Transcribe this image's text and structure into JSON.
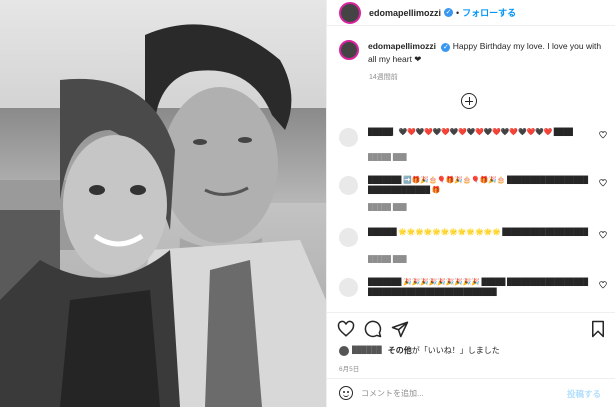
{
  "post": {
    "author": "edomapellimozzi",
    "follow_label": "フォローする",
    "caption": "Happy Birthday my love. I love you with all my heart ❤",
    "caption_time": "14週間前"
  },
  "comments": [
    {
      "text": "█████▎ 🖤❤️🖤❤️🖤❤️🖤❤️🖤❤️🖤❤️🖤❤️🖤❤️🖤❤️ ████",
      "meta": "█████  ███"
    },
    {
      "text": "███████ ➡️🎁🎉🎂🎈🎁🎉🎂🎈🎁🎉🎂 ██████████████████████████████ 🎁",
      "meta": "█████  ███"
    },
    {
      "text": "██████ 🌟🌟🌟🌟🌟🌟🌟🌟🌟🌟🌟🌟 ██████████████████",
      "meta": "█████  ███"
    },
    {
      "text": "███████ 🎉🎉🎉🎉🎉🎉🎉🎉🎉 █████ ████████████████████████████████████████████",
      "meta": "█████  ███"
    }
  ],
  "likes": {
    "liked_by": "██████",
    "label_prefix": "その他",
    "label_suffix": "が「いいね！」しました"
  },
  "post_date": "6月5日",
  "add_comment": {
    "placeholder": "コメントを追加...",
    "post_label": "投稿する"
  }
}
